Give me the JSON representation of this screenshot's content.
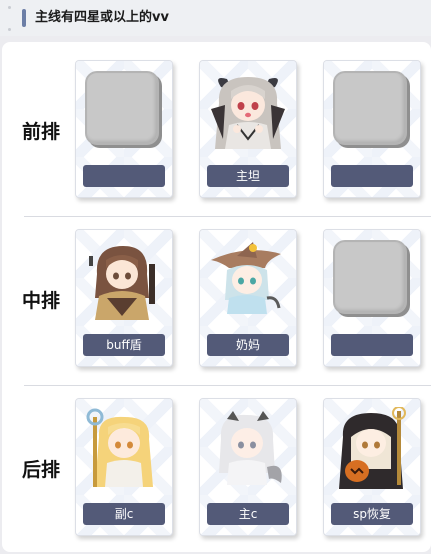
{
  "header": {
    "title": "主线有四星或以上的vv"
  },
  "rows": [
    {
      "label": "前排",
      "slots": [
        {
          "name": "",
          "filled": false
        },
        {
          "name": "主坦",
          "filled": true,
          "icon": "silver-hair-horned-girl-portrait"
        },
        {
          "name": "",
          "filled": false
        }
      ]
    },
    {
      "label": "中排",
      "slots": [
        {
          "name": "buff盾",
          "filled": true,
          "icon": "brown-hair-girl-portrait"
        },
        {
          "name": "奶妈",
          "filled": true,
          "icon": "witch-hat-girl-portrait"
        },
        {
          "name": "",
          "filled": false
        }
      ]
    },
    {
      "label": "后排",
      "slots": [
        {
          "name": "副c",
          "filled": true,
          "icon": "blonde-staff-girl-portrait"
        },
        {
          "name": "主c",
          "filled": true,
          "icon": "white-hair-tail-girl-portrait"
        },
        {
          "name": "sp恢复",
          "filled": true,
          "icon": "nun-pumpkin-girl-portrait"
        }
      ]
    }
  ],
  "colors": {
    "accent": "#6c7ea6",
    "tag_bg": "#535a78",
    "placeholder": "#c8c8c8"
  }
}
